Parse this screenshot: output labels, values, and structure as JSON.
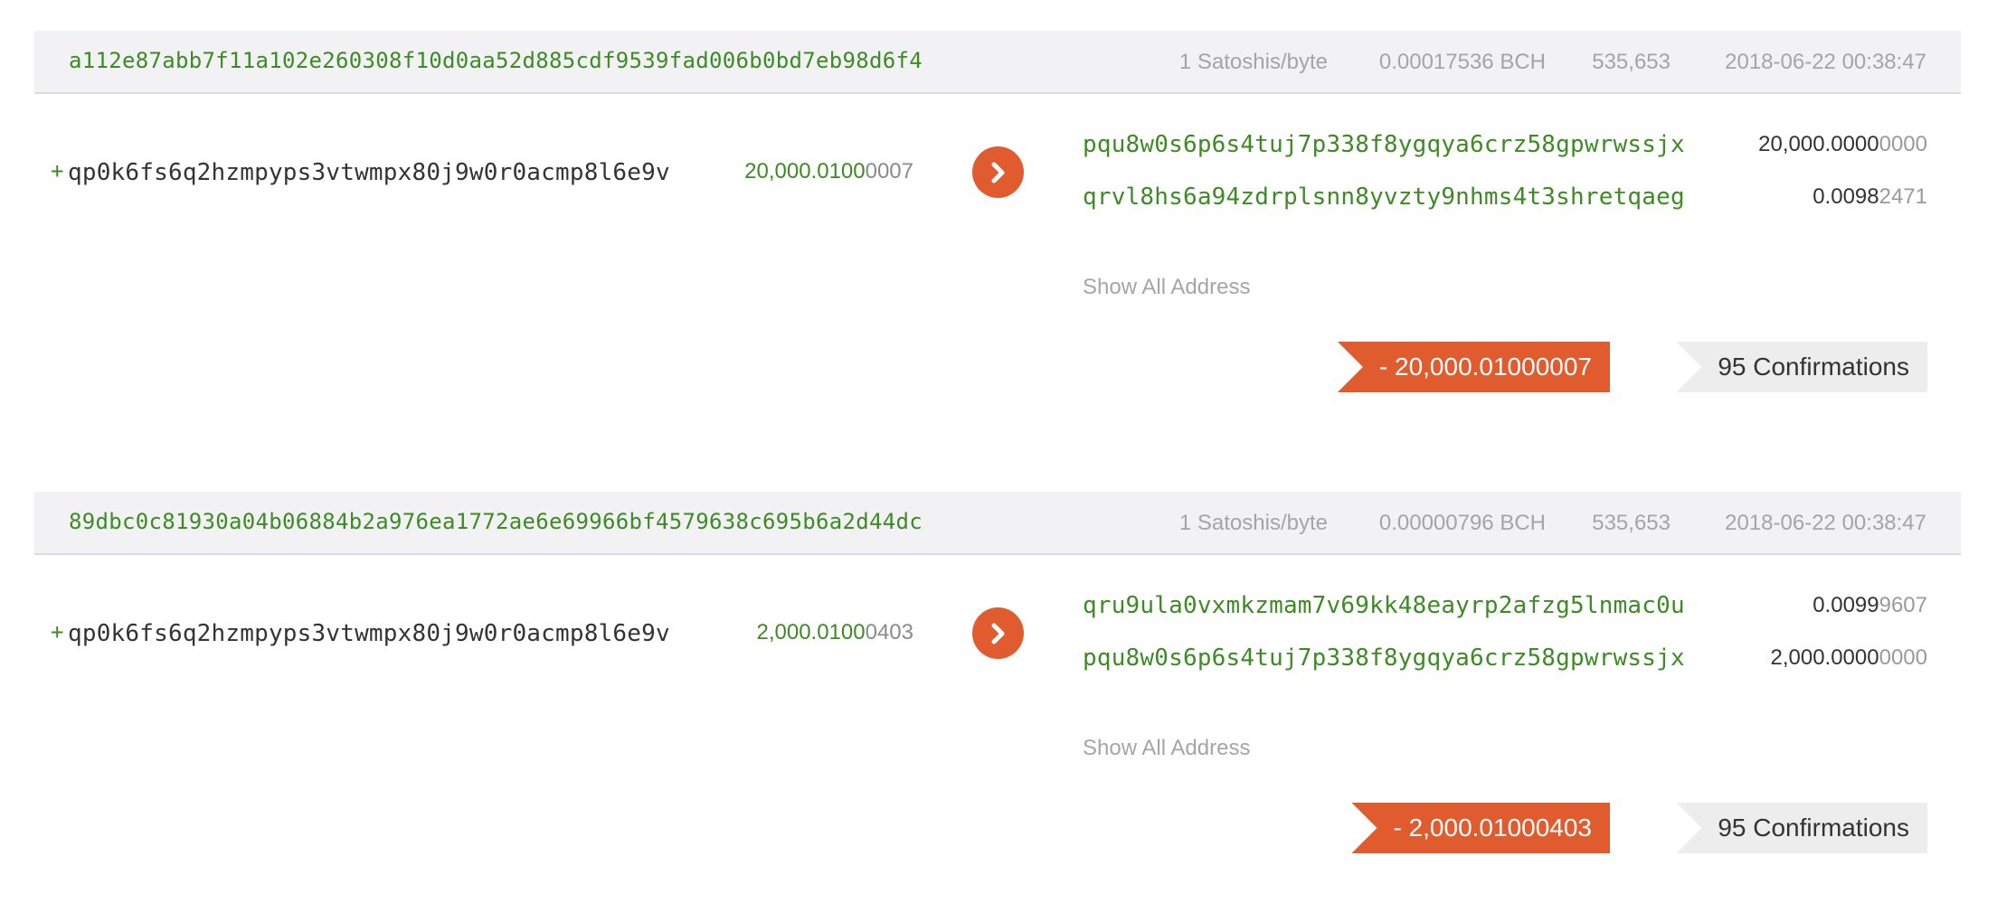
{
  "transactions": [
    {
      "hash": "a112e87abb7f11a102e260308f10d0aa52d885cdf9539fad006b0bd7eb98d6f4",
      "fee_rate": "1 Satoshis/byte",
      "fee": "0.00017536 BCH",
      "block": "535,653",
      "time": "2018-06-22 00:38:47",
      "input": {
        "sign": "+",
        "address": "qp0k6fs6q2hzmpyps3vtwmpx80j9w0r0acmp8l6e9v",
        "amount_strong": "20,000.0100",
        "amount_light": "0007"
      },
      "outputs": [
        {
          "address": "pqu8w0s6p6s4tuj7p338f8ygqya6crz58gpwrwssjx",
          "amount_strong": "20,000.0000",
          "amount_light": "0000"
        },
        {
          "address": "qrvl8hs6a94zdrplsnn8yvzty9nhms4t3shretqaeg",
          "amount_strong": "0.0098",
          "amount_light": "2471"
        }
      ],
      "show_all_label": "Show All Address",
      "total": "- 20,000.01000007",
      "confirmations": "95 Confirmations"
    },
    {
      "hash": "89dbc0c81930a04b06884b2a976ea1772ae6e69966bf4579638c695b6a2d44dc",
      "fee_rate": "1 Satoshis/byte",
      "fee": "0.00000796 BCH",
      "block": "535,653",
      "time": "2018-06-22 00:38:47",
      "input": {
        "sign": "+",
        "address": "qp0k6fs6q2hzmpyps3vtwmpx80j9w0r0acmp8l6e9v",
        "amount_strong": "2,000.0100",
        "amount_light": "0403"
      },
      "outputs": [
        {
          "address": "qru9ula0vxmkzmam7v69kk48eayrp2afzg5lnmac0u",
          "amount_strong": "0.0099",
          "amount_light": "9607"
        },
        {
          "address": "pqu8w0s6p6s4tuj7p338f8ygqya6crz58gpwrwssjx",
          "amount_strong": "2,000.0000",
          "amount_light": "0000"
        }
      ],
      "show_all_label": "Show All Address",
      "total": "- 2,000.01000403",
      "confirmations": "95 Confirmations"
    }
  ],
  "icons": {
    "arrow": "chevron-right-icon"
  },
  "colors": {
    "accent": "#e05c2f",
    "address_green": "#3d8b24",
    "header_bg": "#f2f2f5",
    "muted": "#a5a5a5",
    "confirm_bg": "#ededed"
  }
}
